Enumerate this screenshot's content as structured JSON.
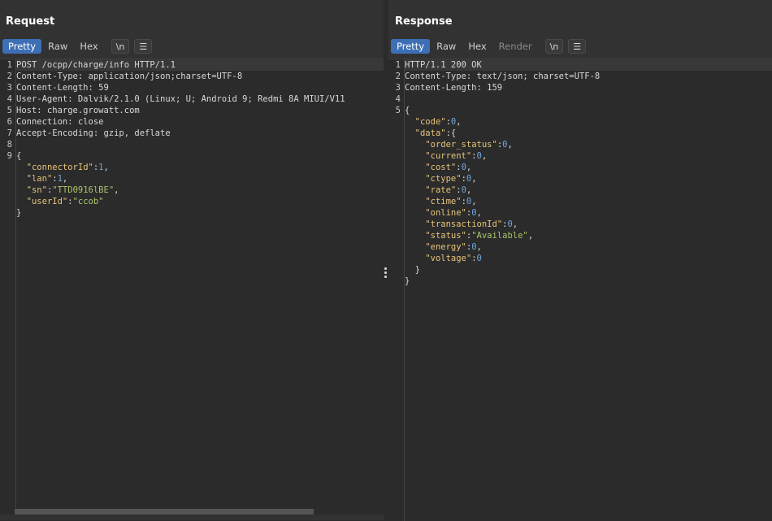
{
  "request": {
    "title": "Request",
    "tabs": [
      "Pretty",
      "Raw",
      "Hex"
    ],
    "newline_label": "\\n",
    "menu_icon": "hamburger-icon",
    "lines": [
      "POST /ocpp/charge/info HTTP/1.1",
      "Content-Type: application/json;charset=UTF-8",
      "Content-Length: 59",
      "User-Agent: Dalvik/2.1.0 (Linux; U; Android 9; Redmi 8A MIUI/V11",
      "Host: charge.growatt.com",
      "Connection: close",
      "Accept-Encoding: gzip, deflate",
      "",
      "{",
      "  \"connectorId\":1,",
      "  \"lan\":1,",
      "  \"sn\":\"TTD0916lBE\",",
      "  \"userId\":\"ccob\"",
      "}"
    ],
    "line_numbers": [
      "1",
      "2",
      "3",
      "4",
      "5",
      "6",
      "7",
      "8",
      "9"
    ]
  },
  "response": {
    "title": "Response",
    "tabs": [
      "Pretty",
      "Raw",
      "Hex",
      "Render"
    ],
    "newline_label": "\\n",
    "menu_icon": "hamburger-icon",
    "lines": [
      "HTTP/1.1 200 OK",
      "Content-Type: text/json; charset=UTF-8",
      "Content-Length: 159",
      "",
      "{",
      "  \"code\":0,",
      "  \"data\":{",
      "    \"order_status\":0,",
      "    \"current\":0,",
      "    \"cost\":0,",
      "    \"ctype\":0,",
      "    \"rate\":0,",
      "    \"ctime\":0,",
      "    \"online\":0,",
      "    \"transactionId\":0,",
      "    \"status\":\"Available\",",
      "    \"energy\":0,",
      "    \"voltage\":0",
      "  }",
      "}"
    ],
    "line_numbers": [
      "1",
      "2",
      "3",
      "4",
      "5"
    ]
  },
  "layout_toggle": [
    "side-by-side-icon",
    "stacked-icon",
    "single-pane-icon"
  ],
  "colors": {
    "accent": "#3d6fb5",
    "key": "#e6c37a",
    "string": "#a8c46a",
    "number": "#6fa7e0"
  }
}
